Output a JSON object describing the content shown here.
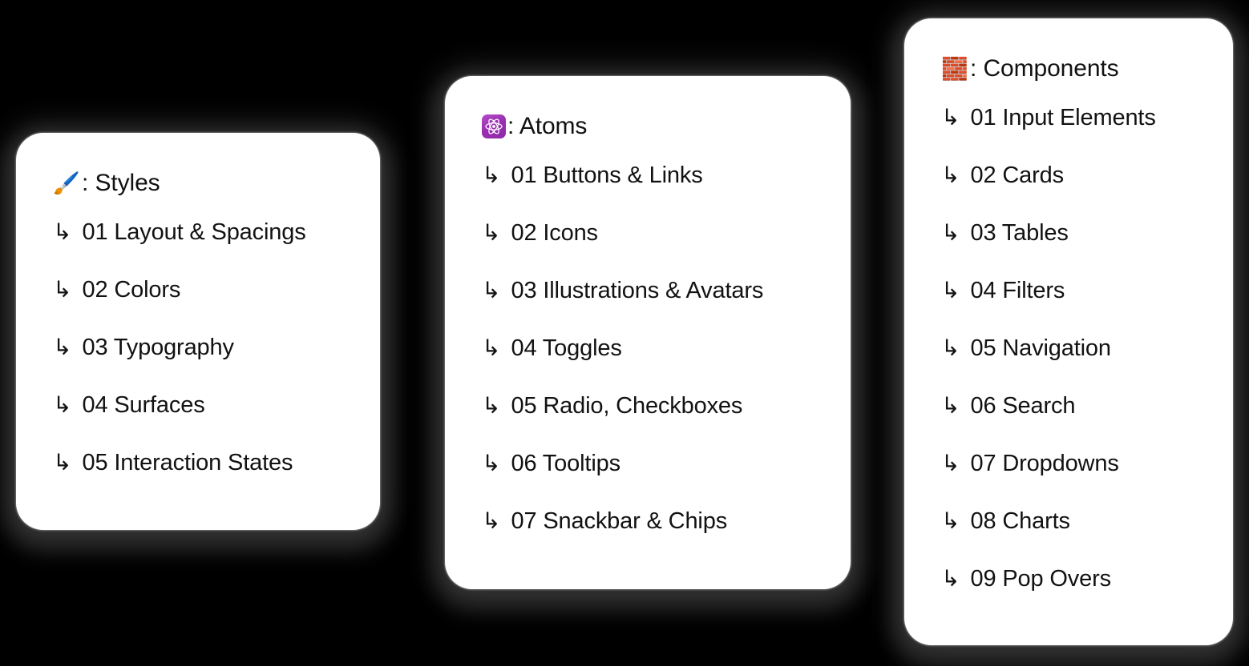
{
  "background_color": "#000000",
  "card_color": "#ffffff",
  "text_color": "#121212",
  "accent_purple": "#9c2fb4",
  "accent_brick": "#c0492b",
  "arrow_glyph": "↳",
  "cards": [
    {
      "id": "styles",
      "emoji": "🖌️",
      "emoji_name": "paintbrush-emoji",
      "title": ": Styles",
      "items": [
        "01 Layout & Spacings",
        "02 Colors",
        "03 Typography",
        "04 Surfaces",
        "05 Interaction States"
      ]
    },
    {
      "id": "atoms",
      "emoji": "⚛️",
      "emoji_name": "atom-symbol-emoji",
      "title": ": Atoms",
      "items": [
        "01 Buttons & Links",
        "02 Icons",
        "03 Illustrations & Avatars",
        "04 Toggles",
        "05 Radio, Checkboxes",
        "06 Tooltips",
        "07 Snackbar & Chips"
      ]
    },
    {
      "id": "components",
      "emoji": "🧱",
      "emoji_name": "brick-emoji",
      "title": ": Components",
      "items": [
        "01 Input Elements",
        "02 Cards",
        "03 Tables",
        "04 Filters",
        "05 Navigation",
        "06 Search",
        "07 Dropdowns",
        "08 Charts",
        "09 Pop Overs"
      ]
    }
  ]
}
